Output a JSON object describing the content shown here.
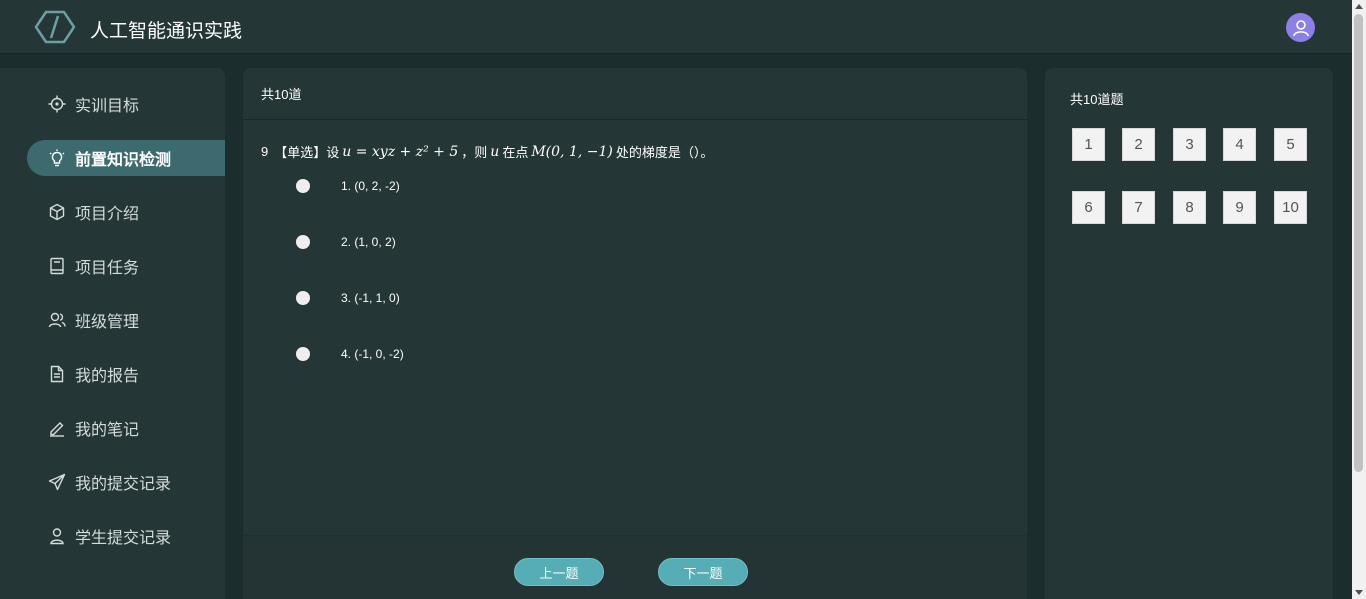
{
  "header": {
    "app_title": "人工智能通识实践",
    "logo_icon": "hexagon-logo-icon",
    "avatar_icon": "user-avatar-icon"
  },
  "sidebar": {
    "items": [
      {
        "label": "实训目标",
        "icon": "target-icon"
      },
      {
        "label": "前置知识检测",
        "icon": "lightbulb-icon"
      },
      {
        "label": "项目介绍",
        "icon": "cube-icon"
      },
      {
        "label": "项目任务",
        "icon": "clipboard-icon"
      },
      {
        "label": "班级管理",
        "icon": "users-icon"
      },
      {
        "label": "我的报告",
        "icon": "document-icon"
      },
      {
        "label": "我的笔记",
        "icon": "pen-icon"
      },
      {
        "label": "我的提交记录",
        "icon": "send-icon"
      },
      {
        "label": "学生提交记录",
        "icon": "student-icon"
      }
    ],
    "active_index": 1
  },
  "main": {
    "header": "共10道",
    "question": {
      "number": "9",
      "type": "【单选】",
      "prefix": "设",
      "formula": "u = xyz + z² + 5",
      "middle": "，则",
      "var": "u",
      "middle2": "在点",
      "point": "M(0, 1, −1)",
      "suffix": "处的梯度是（）。"
    },
    "options": [
      "1. (0, 2, -2)",
      "2. (1, 0, 2)",
      "3. (-1, 1, 0)",
      "4. (-1, 0, -2)"
    ],
    "prev_button": "上一题",
    "next_button": "下一题"
  },
  "right_panel": {
    "title": "共10道题",
    "numbers": [
      "1",
      "2",
      "3",
      "4",
      "5",
      "6",
      "7",
      "8",
      "9",
      "10"
    ]
  },
  "colors": {
    "background": "#1c2d2d",
    "panel": "#253637",
    "active_nav": "#3c6a6f",
    "button": "#56adb5",
    "avatar": "#8c7fe6"
  }
}
